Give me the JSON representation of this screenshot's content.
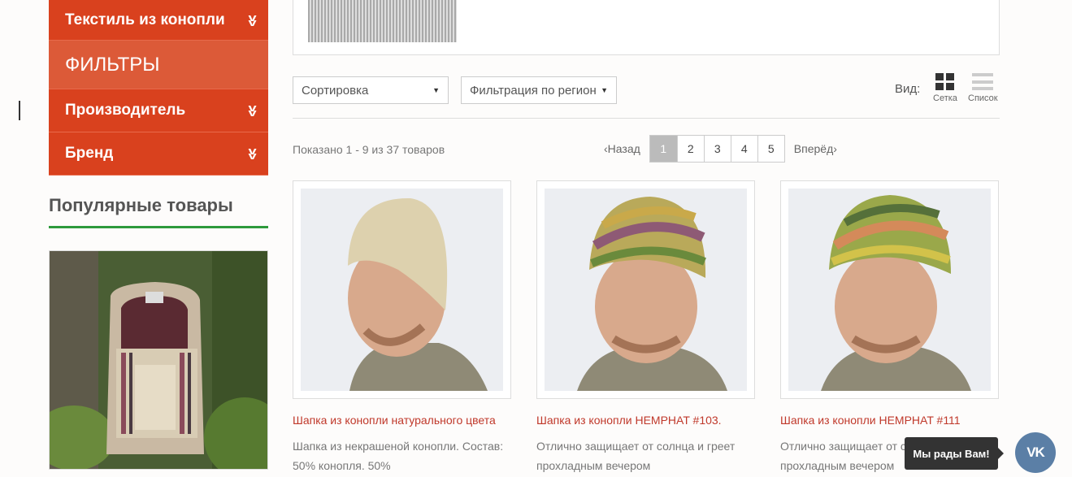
{
  "sidebar": {
    "categories": [
      {
        "label": "Текстиль из конопли"
      },
      {
        "label": "ФИЛЬТРЫ"
      },
      {
        "label": "Производитель"
      },
      {
        "label": "Бренд"
      }
    ],
    "popular_title": "Популярные товары"
  },
  "toolbar": {
    "sort_value": "Сортировка",
    "region_value": "Фильтрация по регион",
    "view_label": "Вид:",
    "grid_label": "Сетка",
    "list_label": "Список"
  },
  "listing": {
    "shown_text": "Показано 1 - 9 из 37 товаров",
    "prev_label": "Назад",
    "next_label": "Вперёд",
    "pages": [
      "1",
      "2",
      "3",
      "4",
      "5"
    ]
  },
  "products": [
    {
      "title": "Шапка из конопли натурального цвета",
      "desc": "Шапка из некрашеной конопли. Состав: 50% конопля. 50%"
    },
    {
      "title": "Шапка из конопли HEMPHAT #103.",
      "desc": "Отлично защищает от солнца и греет прохладным вечером"
    },
    {
      "title": "Шапка из конопли HEMPHAT #111",
      "desc": "Отлично защищает от солнца и греет прохладным вечером"
    }
  ],
  "widget": {
    "tooltip": "Мы рады Вам!",
    "vk_label": "VK"
  },
  "colors": {
    "menu_bg": "#d9411e",
    "accent_green": "#2e9a3c",
    "link_red": "#c0392b"
  }
}
